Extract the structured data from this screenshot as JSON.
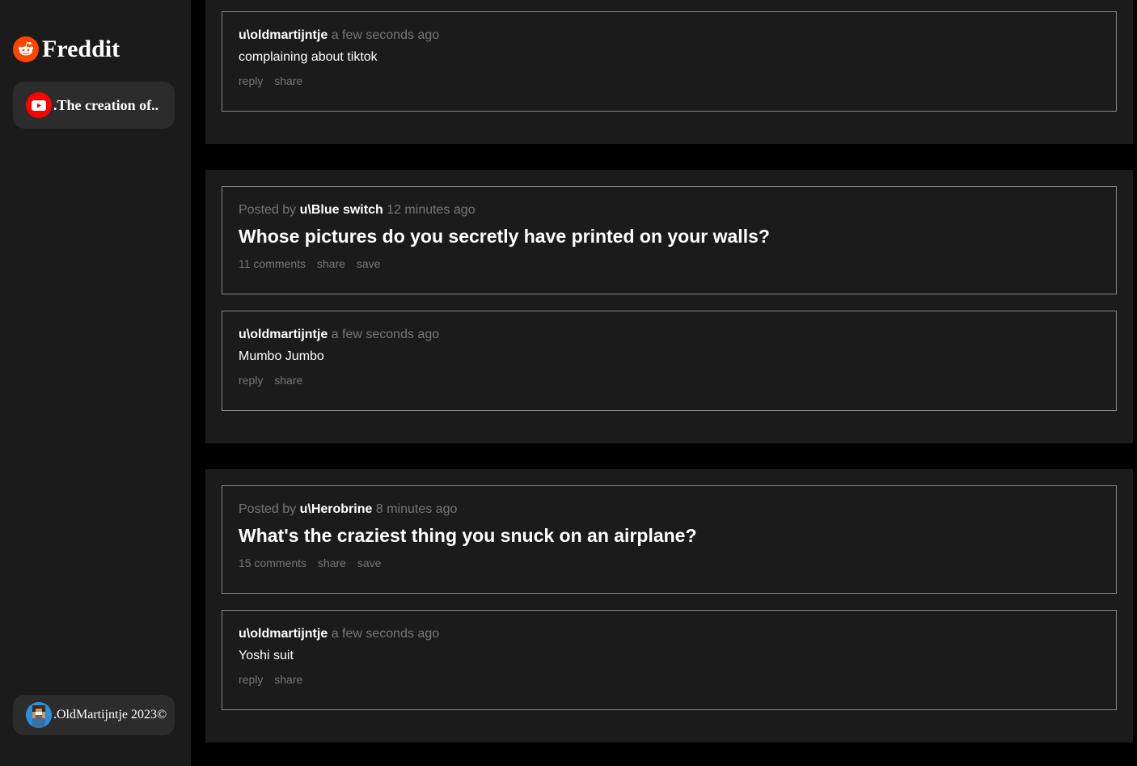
{
  "app": {
    "name": "Freddit",
    "brand_color": "#ff4500",
    "logo_icon": "reddit-alien-icon"
  },
  "sidebar": {
    "video_card": {
      "icon": "youtube-play-icon",
      "label": ".The creation of.."
    },
    "footer_card": {
      "icon": "pixel-avatar-icon",
      "label": ".OldMartijntje 2023©"
    }
  },
  "blocks": [
    {
      "comment": {
        "user": "u\\oldmartijntje",
        "time": "a few seconds ago",
        "text": "complaining about tiktok",
        "actions": [
          "reply",
          "share"
        ]
      }
    },
    {
      "post": {
        "posted_by_prefix": "Posted by",
        "user": "u\\Blue switch",
        "time": "12 minutes ago",
        "title": "Whose pictures do you secretly have printed on your walls?",
        "actions": [
          "11 comments",
          "share",
          "save"
        ]
      },
      "comment": {
        "user": "u\\oldmartijntje",
        "time": "a few seconds ago",
        "text": "Mumbo Jumbo",
        "actions": [
          "reply",
          "share"
        ]
      }
    },
    {
      "post": {
        "posted_by_prefix": "Posted by",
        "user": "u\\Herobrine",
        "time": "8 minutes ago",
        "title": "What's the craziest thing you snuck on an airplane?",
        "actions": [
          "15 comments",
          "share",
          "save"
        ]
      },
      "comment": {
        "user": "u\\oldmartijntje",
        "time": "a few seconds ago",
        "text": "Yoshi suit",
        "actions": [
          "reply",
          "share"
        ]
      }
    }
  ]
}
